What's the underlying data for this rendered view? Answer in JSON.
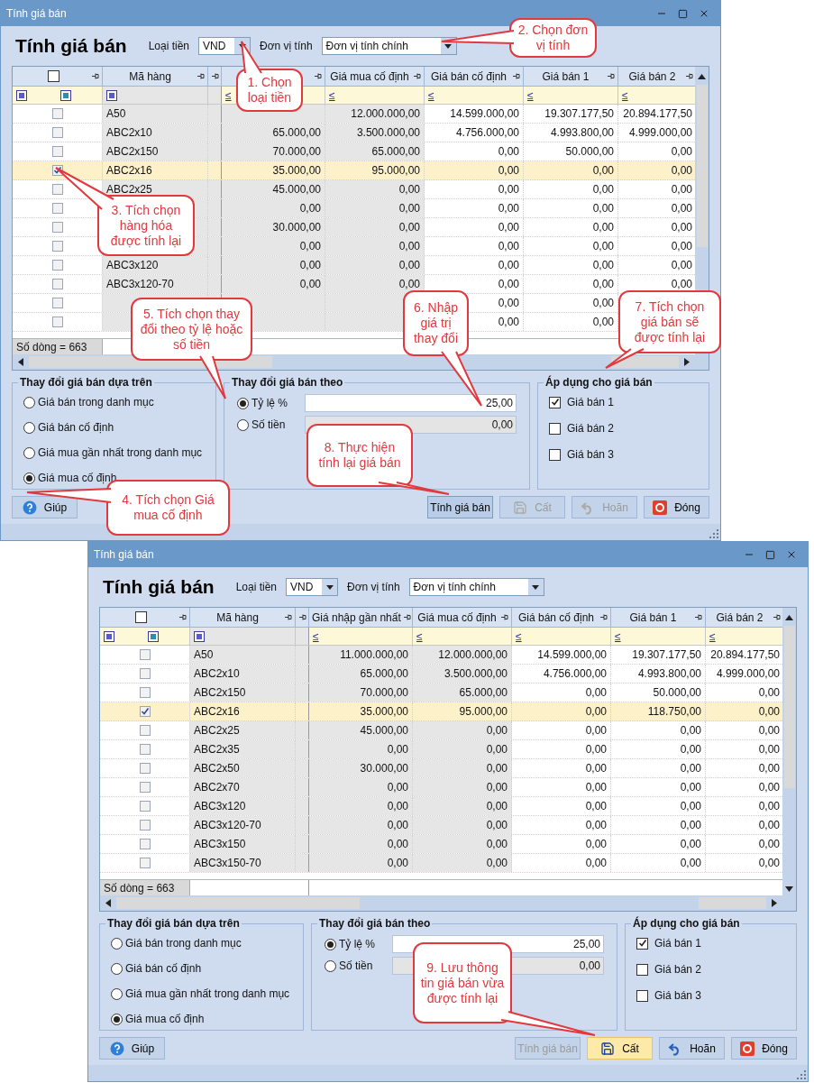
{
  "windows": [
    {
      "title": "Tính giá bán",
      "heading": "Tính giá bán",
      "currency": {
        "label": "Loại tiền",
        "value": "VND"
      },
      "unit": {
        "label": "Đơn vị tính",
        "value": "Đơn vị tính chính"
      },
      "all_checked": false,
      "columns": [
        {
          "label": "Mã hàng"
        },
        {
          "filter": "≤"
        },
        {
          "label": "Giá mua cố định",
          "filter": "≤"
        },
        {
          "label": "Giá bán cố định",
          "filter": "≤"
        },
        {
          "label": "Giá bán 1",
          "filter": "≤"
        },
        {
          "label": "Giá bán 2",
          "filter": "≤"
        }
      ],
      "rows": [
        {
          "checked": false,
          "selected": false,
          "cells": [
            "A50",
            "",
            "12.000.000,00",
            "14.599.000,00",
            "19.307.177,50",
            "20.894.177,50"
          ]
        },
        {
          "checked": false,
          "selected": false,
          "cells": [
            "ABC2x10",
            "65.000,00",
            "3.500.000,00",
            "4.756.000,00",
            "4.993.800,00",
            "4.999.000,00"
          ]
        },
        {
          "checked": false,
          "selected": false,
          "cells": [
            "ABC2x150",
            "70.000,00",
            "65.000,00",
            "0,00",
            "50.000,00",
            "0,00"
          ]
        },
        {
          "checked": true,
          "selected": true,
          "cells": [
            "ABC2x16",
            "35.000,00",
            "95.000,00",
            "0,00",
            "0,00",
            "0,00"
          ]
        },
        {
          "checked": false,
          "selected": false,
          "cells": [
            "ABC2x25",
            "45.000,00",
            "0,00",
            "0,00",
            "0,00",
            "0,00"
          ]
        },
        {
          "checked": false,
          "selected": false,
          "cells": [
            "",
            "0,00",
            "0,00",
            "0,00",
            "0,00",
            "0,00"
          ]
        },
        {
          "checked": false,
          "selected": false,
          "cells": [
            "",
            "30.000,00",
            "0,00",
            "0,00",
            "0,00",
            "0,00"
          ]
        },
        {
          "checked": false,
          "selected": false,
          "cells": [
            "",
            "0,00",
            "0,00",
            "0,00",
            "0,00",
            "0,00"
          ]
        },
        {
          "checked": false,
          "selected": false,
          "cells": [
            "ABC3x120",
            "0,00",
            "0,00",
            "0,00",
            "0,00",
            "0,00"
          ]
        },
        {
          "checked": false,
          "selected": false,
          "cells": [
            "ABC3x120-70",
            "0,00",
            "0,00",
            "0,00",
            "0,00",
            "0,00"
          ]
        },
        {
          "checked": false,
          "selected": false,
          "cells": [
            "",
            "",
            "",
            "0,00",
            "0,00",
            ""
          ]
        },
        {
          "checked": false,
          "selected": false,
          "cells": [
            "",
            "",
            "",
            "0,00",
            "0,00",
            ""
          ]
        }
      ],
      "row_count": "Số dòng = 663",
      "based_on": {
        "title": "Thay đổi giá bán dựa trên",
        "options": [
          {
            "label": "Giá bán trong danh mục",
            "selected": false
          },
          {
            "label": "Giá bán cố định",
            "selected": false
          },
          {
            "label": "Giá mua gần nhất trong danh mục",
            "selected": false
          },
          {
            "label": "Giá mua cố định",
            "selected": true
          }
        ]
      },
      "change_by": {
        "title": "Thay đổi giá bán theo",
        "options": [
          {
            "label": "Tỷ lệ %",
            "selected": true,
            "value": "25,00",
            "disabled": false
          },
          {
            "label": "Số tiền",
            "selected": false,
            "value": "0,00",
            "disabled": true
          }
        ]
      },
      "apply_to": {
        "title": "Áp dụng cho giá bán",
        "items": [
          {
            "label": "Giá bán 1",
            "checked": true
          },
          {
            "label": "Giá bán 2",
            "checked": false
          },
          {
            "label": "Giá bán 3",
            "checked": false
          }
        ]
      },
      "buttons": [
        {
          "label": "Giúp",
          "kind": "help",
          "disabled": false,
          "highlighted": false
        },
        {
          "label": "Tính giá bán",
          "kind": "calc",
          "disabled": false,
          "highlighted": true
        },
        {
          "label": "Cất",
          "kind": "save",
          "disabled": true,
          "highlighted": false
        },
        {
          "label": "Hoãn",
          "kind": "undo",
          "disabled": true,
          "highlighted": false
        },
        {
          "label": "Đóng",
          "kind": "close",
          "disabled": false,
          "highlighted": false
        }
      ]
    },
    {
      "title": "Tính giá bán",
      "heading": "Tính giá bán",
      "currency": {
        "label": "Loại tiền",
        "value": "VND"
      },
      "unit": {
        "label": "Đơn vị tính",
        "value": "Đơn vị tính chính"
      },
      "all_checked": false,
      "columns": [
        {
          "label": "Mã hàng"
        },
        {
          "label": "Giá nhập gần nhất",
          "filter": "≤"
        },
        {
          "label": "Giá mua cố định",
          "filter": "≤"
        },
        {
          "label": "Giá bán cố định",
          "filter": "≤"
        },
        {
          "label": "Giá bán 1",
          "filter": "≤"
        },
        {
          "label": "Giá bán 2",
          "filter": "≤"
        }
      ],
      "rows": [
        {
          "checked": false,
          "selected": false,
          "cells": [
            "A50",
            "11.000.000,00",
            "12.000.000,00",
            "14.599.000,00",
            "19.307.177,50",
            "20.894.177,50"
          ]
        },
        {
          "checked": false,
          "selected": false,
          "cells": [
            "ABC2x10",
            "65.000,00",
            "3.500.000,00",
            "4.756.000,00",
            "4.993.800,00",
            "4.999.000,00"
          ]
        },
        {
          "checked": false,
          "selected": false,
          "cells": [
            "ABC2x150",
            "70.000,00",
            "65.000,00",
            "0,00",
            "50.000,00",
            "0,00"
          ]
        },
        {
          "checked": true,
          "selected": true,
          "cells": [
            "ABC2x16",
            "35.000,00",
            "95.000,00",
            "0,00",
            "118.750,00",
            "0,00"
          ]
        },
        {
          "checked": false,
          "selected": false,
          "cells": [
            "ABC2x25",
            "45.000,00",
            "0,00",
            "0,00",
            "0,00",
            "0,00"
          ]
        },
        {
          "checked": false,
          "selected": false,
          "cells": [
            "ABC2x35",
            "0,00",
            "0,00",
            "0,00",
            "0,00",
            "0,00"
          ]
        },
        {
          "checked": false,
          "selected": false,
          "cells": [
            "ABC2x50",
            "30.000,00",
            "0,00",
            "0,00",
            "0,00",
            "0,00"
          ]
        },
        {
          "checked": false,
          "selected": false,
          "cells": [
            "ABC2x70",
            "0,00",
            "0,00",
            "0,00",
            "0,00",
            "0,00"
          ]
        },
        {
          "checked": false,
          "selected": false,
          "cells": [
            "ABC3x120",
            "0,00",
            "0,00",
            "0,00",
            "0,00",
            "0,00"
          ]
        },
        {
          "checked": false,
          "selected": false,
          "cells": [
            "ABC3x120-70",
            "0,00",
            "0,00",
            "0,00",
            "0,00",
            "0,00"
          ]
        },
        {
          "checked": false,
          "selected": false,
          "cells": [
            "ABC3x150",
            "0,00",
            "0,00",
            "0,00",
            "0,00",
            "0,00"
          ]
        },
        {
          "checked": false,
          "selected": false,
          "cells": [
            "ABC3x150-70",
            "0,00",
            "0,00",
            "0,00",
            "0,00",
            "0,00"
          ]
        }
      ],
      "row_count": "Số dòng = 663",
      "based_on": {
        "title": "Thay đổi giá bán dựa trên",
        "options": [
          {
            "label": "Giá bán trong danh mục",
            "selected": false
          },
          {
            "label": "Giá bán cố định",
            "selected": false
          },
          {
            "label": "Giá mua gần nhất trong danh mục",
            "selected": false
          },
          {
            "label": "Giá mua cố định",
            "selected": true
          }
        ]
      },
      "change_by": {
        "title": "Thay đổi giá bán theo",
        "options": [
          {
            "label": "Tỷ lệ %",
            "selected": true,
            "value": "25,00",
            "disabled": false
          },
          {
            "label": "Số tiền",
            "selected": false,
            "value": "0,00",
            "disabled": true
          }
        ]
      },
      "apply_to": {
        "title": "Áp dụng cho giá bán",
        "items": [
          {
            "label": "Giá bán 1",
            "checked": true
          },
          {
            "label": "Giá bán 2",
            "checked": false
          },
          {
            "label": "Giá bán 3",
            "checked": false
          }
        ]
      },
      "buttons": [
        {
          "label": "Giúp",
          "kind": "help",
          "disabled": false,
          "highlighted": false
        },
        {
          "label": "Tính giá bán",
          "kind": "calc",
          "disabled": true,
          "highlighted": false
        },
        {
          "label": "Cất",
          "kind": "save",
          "disabled": false,
          "highlighted": true
        },
        {
          "label": "Hoãn",
          "kind": "undo",
          "disabled": false,
          "highlighted": false
        },
        {
          "label": "Đóng",
          "kind": "close",
          "disabled": false,
          "highlighted": false
        }
      ]
    }
  ],
  "callouts": [
    {
      "text": "1. Chọn loại tiền"
    },
    {
      "text": "2. Chọn đơn vị tính"
    },
    {
      "text": "3. Tích chọn hàng hóa được tính lại"
    },
    {
      "text": "5. Tích chọn thay đổi theo tỷ lệ hoặc số tiền"
    },
    {
      "text": "4. Tích chọn Giá mua cố định"
    },
    {
      "text": "6. Nhập giá trị thay đổi"
    },
    {
      "text": "7. Tích chọn giá bán sẽ được tính lại"
    },
    {
      "text": "8. Thực hiện tính lại giá bán"
    },
    {
      "text": "9. Lưu thông tin giá bán vừa được tính lại"
    }
  ]
}
